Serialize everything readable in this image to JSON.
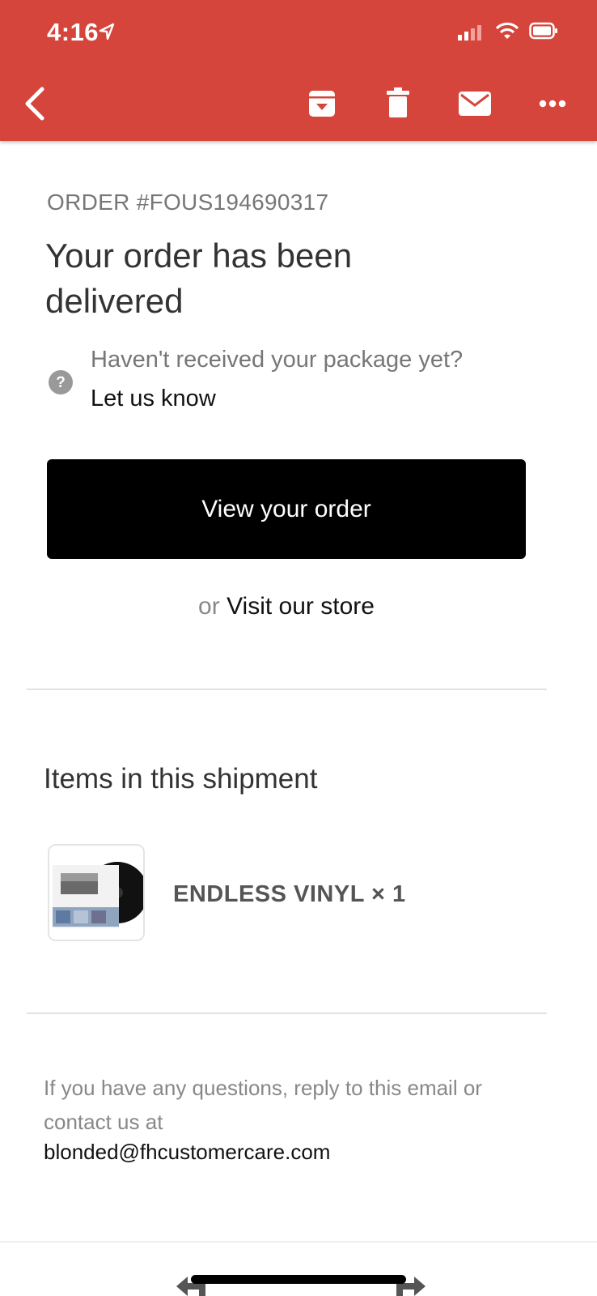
{
  "status_bar": {
    "time": "4:16",
    "icons": [
      "location-arrow-icon",
      "signal-icon",
      "wifi-icon",
      "battery-icon"
    ]
  },
  "toolbar": {
    "color": "#d6453b",
    "icons": [
      "back-icon",
      "archive-icon",
      "trash-icon",
      "mail-icon",
      "more-icon"
    ]
  },
  "email": {
    "order_number": "ORDER #FOUS194690317",
    "headline": "Your order has been delivered",
    "help_question": "Haven't received your package yet?",
    "help_link": "Let us know",
    "primary_button": "View your order",
    "secondary_prefix": "or",
    "secondary_link": "Visit our store",
    "items_title": "Items in this shipment",
    "items": [
      {
        "name": "ENDLESS VINYL × 1"
      }
    ],
    "footer_text": "If you have any questions, reply to this email or contact us at",
    "footer_email": "blonded@fhcustomercare.com"
  }
}
